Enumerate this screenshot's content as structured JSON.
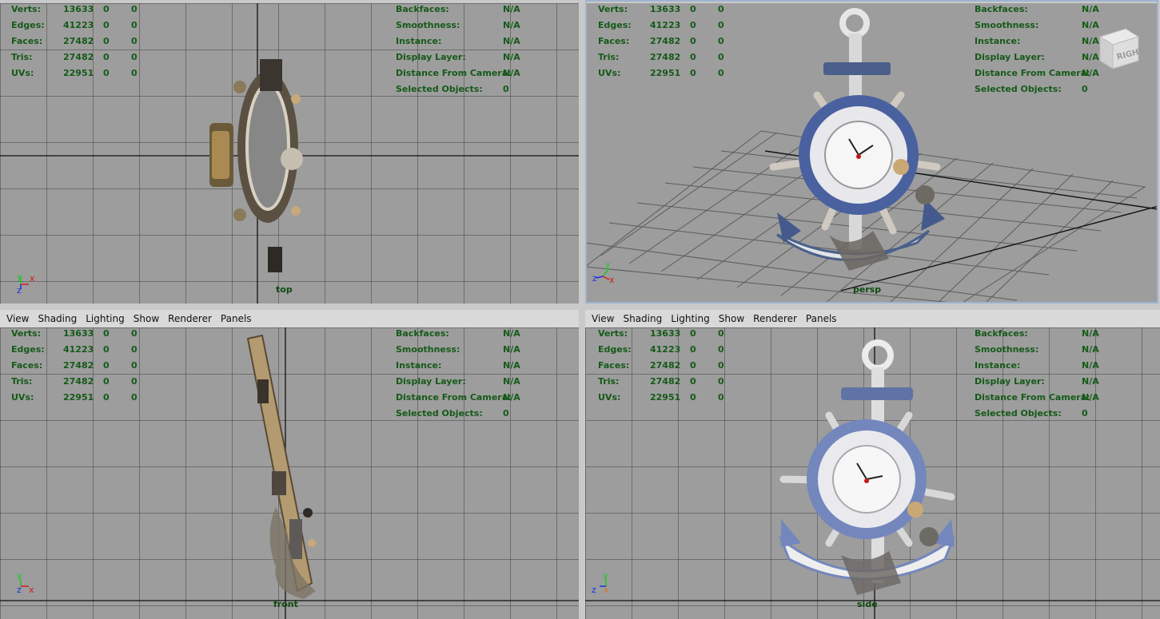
{
  "menu": {
    "view": "View",
    "shading": "Shading",
    "lighting": "Lighting",
    "show": "Show",
    "renderer": "Renderer",
    "panels": "Panels"
  },
  "stats": {
    "verts": {
      "label": "Verts:",
      "a": "13633",
      "b": "0",
      "c": "0"
    },
    "edges": {
      "label": "Edges:",
      "a": "41223",
      "b": "0",
      "c": "0"
    },
    "faces": {
      "label": "Faces:",
      "a": "27482",
      "b": "0",
      "c": "0"
    },
    "tris": {
      "label": "Tris:",
      "a": "27482",
      "b": "0",
      "c": "0"
    },
    "uvs": {
      "label": "UVs:",
      "a": "22951",
      "b": "0",
      "c": "0"
    }
  },
  "info": {
    "backfaces": {
      "label": "Backfaces:",
      "value": "N/A"
    },
    "smoothness": {
      "label": "Smoothness:",
      "value": "N/A"
    },
    "instance": {
      "label": "Instance:",
      "value": "N/A"
    },
    "display_layer": {
      "label": "Display Layer:",
      "value": "N/A"
    },
    "distance": {
      "label": "Distance From Camera:",
      "value": "N/A"
    },
    "selected": {
      "label": "Selected Objects:",
      "value": "0"
    }
  },
  "cameras": {
    "top": "top",
    "persp": "persp",
    "front": "front",
    "side": "side"
  },
  "viewcube": {
    "label": "RIGHT"
  },
  "axes": {
    "x": "x",
    "y": "y",
    "z": "z"
  },
  "colors": {
    "viewport_bg": "#9d9d9d",
    "hud_text": "#155a18",
    "axis_x": "#d41b1b",
    "axis_y": "#1fc41f",
    "axis_z": "#1a2ee0",
    "active_border": "#9fb3cf"
  }
}
